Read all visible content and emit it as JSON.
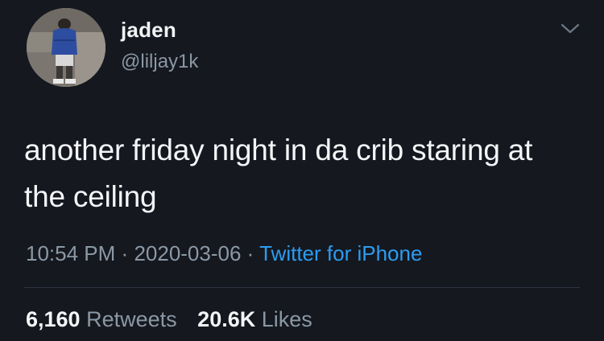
{
  "tweet": {
    "display_name": "jaden",
    "handle": "@liljay1k",
    "text": "another friday night in da crib staring at the ceiling",
    "time": "10:54 PM",
    "date": "2020-03-06",
    "separator": "·",
    "source": "Twitter for iPhone",
    "retweets_count": "6,160",
    "retweets_label": "Retweets",
    "likes_count": "20.6K",
    "likes_label": "Likes"
  },
  "icons": {
    "avatar": "profile-photo",
    "menu": "chevron-down-icon"
  },
  "colors": {
    "background": "#15181f",
    "text": "#f4f5f7",
    "secondary": "#8b98a5",
    "link": "#2c9cf0"
  }
}
